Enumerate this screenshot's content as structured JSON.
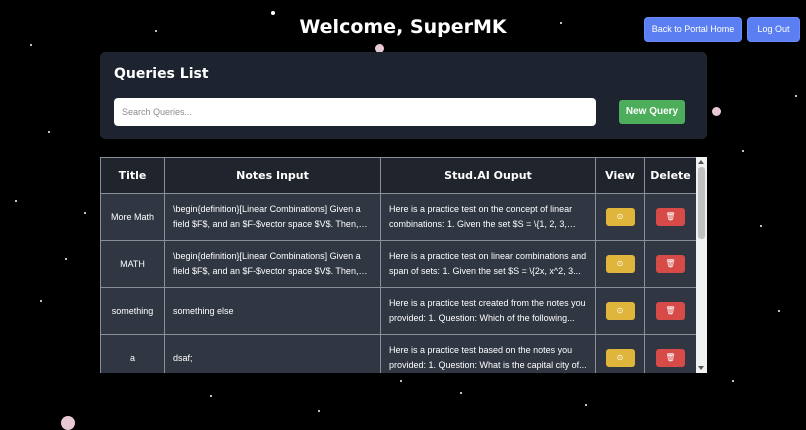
{
  "header": {
    "title": "Welcome, SuperMK",
    "portal_label": "Back to Portal Home",
    "logout_label": "Log Out"
  },
  "panel": {
    "heading": "Queries List",
    "search_placeholder": "Search Queries...",
    "new_query_label": "New Query"
  },
  "table": {
    "columns": [
      "Title",
      "Notes Input",
      "Stud.AI Ouput",
      "View",
      "Delete"
    ],
    "rows": [
      {
        "title": "More Math",
        "notes": "\\begin{definition}[Linear Combinations] Given a field $F$, and an $F-$vector space $V$. Then, gi...",
        "output": "Here is a practice test on the concept of linear combinations: 1. Given the set $S = \\{1, 2, 3, 4\\}..."
      },
      {
        "title": "MATH",
        "notes": "\\begin{definition}[Linear Combinations] Given a field $F$, and an $F-$vector space $V$. Then, gi...",
        "output": "Here is a practice test on linear combinations and span of sets: 1. Given the set $S = \\{2x, x^2, 3..."
      },
      {
        "title": "something",
        "notes": "something else",
        "output": "Here is a practice test created from the notes you provided: 1. Question: Which of the following..."
      },
      {
        "title": "a",
        "notes": "dsaf;",
        "output": "Here is a practice test based on the notes you provided: 1. Question: What is the capital city of..."
      }
    ],
    "view_icon": "eye-icon",
    "delete_icon": "trash-icon"
  },
  "colors": {
    "background": "#000000",
    "panel": "#1d2430",
    "primary_button": "#5b7ff2",
    "new_query": "#4cad5b",
    "view": "#e0b53c",
    "delete": "#d64b48"
  }
}
